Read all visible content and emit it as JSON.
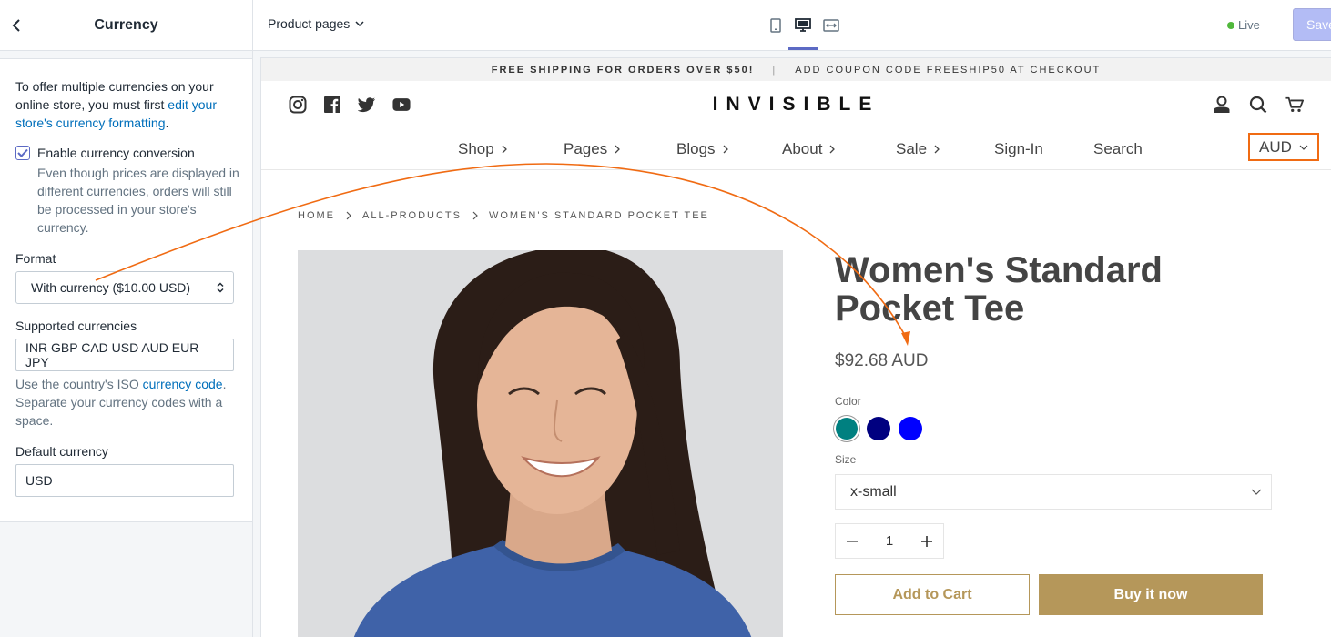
{
  "sidebar": {
    "title": "Currency",
    "intro_text": "To offer multiple currencies on your online store, you must first ",
    "intro_link": "edit your store's currency formatting",
    "intro_end": ".",
    "enable_label": "Enable currency conversion",
    "enable_checked": true,
    "enable_help": "Even though prices are displayed in different currencies, orders will still be processed in your store's currency.",
    "format_label": "Format",
    "format_value": "With currency ($10.00 USD)",
    "supported_label": "Supported currencies",
    "supported_value": "INR GBP CAD USD AUD EUR JPY",
    "supported_help_1": "Use the country's ISO ",
    "supported_help_link": "currency code",
    "supported_help_2": ". Separate your currency codes with a space.",
    "default_label": "Default currency",
    "default_value": "USD"
  },
  "toolbar": {
    "page_selector": "Product pages",
    "status": "Live",
    "save_label": "Save"
  },
  "store": {
    "announcement_1": "FREE SHIPPING FOR ORDERS OVER $50!",
    "announcement_sep": "|",
    "announcement_2": "ADD COUPON CODE FREESHIP50 AT CHECKOUT",
    "logo": "INVISIBLE",
    "nav": [
      {
        "label": "Shop"
      },
      {
        "label": "Pages"
      },
      {
        "label": "Blogs"
      },
      {
        "label": "About"
      },
      {
        "label": "Sale"
      },
      {
        "label": "Sign-In"
      },
      {
        "label": "Search"
      }
    ],
    "currency": "AUD",
    "breadcrumb": [
      "HOME",
      "ALL-PRODUCTS",
      "WOMEN'S STANDARD POCKET TEE"
    ],
    "product_title": "Women's Standard Pocket Tee",
    "price": "$92.68 AUD",
    "color_label": "Color",
    "colors": [
      "#008080",
      "#000080",
      "#0000ff"
    ],
    "size_label": "Size",
    "size_value": "x-small",
    "quantity": "1",
    "add_to_cart": "Add to Cart",
    "buy_now": "Buy it now"
  },
  "accent": {
    "annotation": "#f06b13",
    "brand_gold": "#b5975a",
    "link": "#006fbb",
    "save_disabled": "#b3bcf5"
  }
}
